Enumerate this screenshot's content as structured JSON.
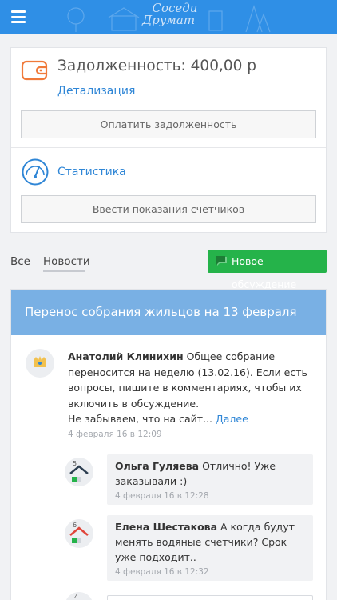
{
  "header": {
    "logo_line1": "Соседи",
    "logo_line2": "Друмат"
  },
  "balance": {
    "title": "Задолженность: 400,00 р",
    "detail_link": "Детализация",
    "pay_button": "Оплатить задолженность"
  },
  "stats": {
    "link": "Статистика",
    "meter_button": "Ввести показания счетчиков"
  },
  "tabs": {
    "all": "Все",
    "news": "Новости",
    "active": "Новости"
  },
  "new_discussion_button": "Новое обсуждение",
  "post": {
    "title": "Перенос собрания жильцов на 13 февраля",
    "author": "Анатолий Клинихин",
    "text_line1": " Общее собрание переносится на неделю (13.02.16). Если есть вопросы, пишите в комментариях, чтобы их включить в обсуждение.",
    "text_line2": "Не забываем, что на сайт... ",
    "more": "Далее",
    "timestamp": "4 февраля 16 в 12:09"
  },
  "comments": [
    {
      "badge": "5",
      "author": "Ольга Гуляева",
      "text": " Отлично! Уже заказывали :)",
      "timestamp": "4 февраля 16 в 12:28"
    },
    {
      "badge": "6",
      "author": "Елена Шестакова",
      "text": " А когда будут менять водяные счетчики? Срок уже подходит..",
      "timestamp": "4 февраля 16 в 12:32"
    },
    {
      "badge": "4"
    }
  ],
  "colors": {
    "header": "#2f8fe6",
    "post_header": "#79b0e4",
    "link": "#2f86d6",
    "accent_orange": "#f07a3a",
    "new_button": "#25b34a"
  },
  "icons": {
    "menu": "hamburger-icon",
    "debt": "wallet-icon",
    "stats": "gauge-icon",
    "new_discussion": "chat-icon"
  }
}
